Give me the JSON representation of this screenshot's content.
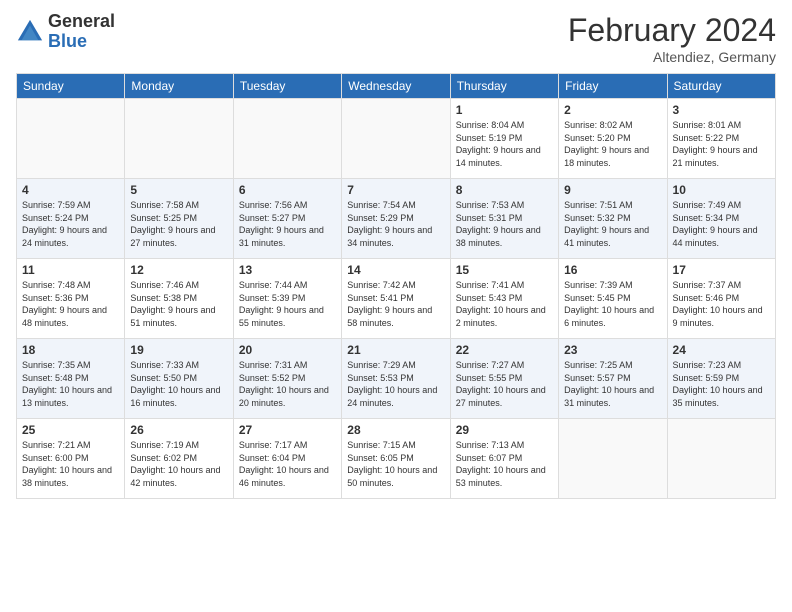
{
  "logo": {
    "general": "General",
    "blue": "Blue"
  },
  "title": "February 2024",
  "location": "Altendiez, Germany",
  "weekdays": [
    "Sunday",
    "Monday",
    "Tuesday",
    "Wednesday",
    "Thursday",
    "Friday",
    "Saturday"
  ],
  "weeks": [
    [
      {
        "day": "",
        "sunrise": "",
        "sunset": "",
        "daylight": ""
      },
      {
        "day": "",
        "sunrise": "",
        "sunset": "",
        "daylight": ""
      },
      {
        "day": "",
        "sunrise": "",
        "sunset": "",
        "daylight": ""
      },
      {
        "day": "",
        "sunrise": "",
        "sunset": "",
        "daylight": ""
      },
      {
        "day": "1",
        "sunrise": "Sunrise: 8:04 AM",
        "sunset": "Sunset: 5:19 PM",
        "daylight": "Daylight: 9 hours and 14 minutes."
      },
      {
        "day": "2",
        "sunrise": "Sunrise: 8:02 AM",
        "sunset": "Sunset: 5:20 PM",
        "daylight": "Daylight: 9 hours and 18 minutes."
      },
      {
        "day": "3",
        "sunrise": "Sunrise: 8:01 AM",
        "sunset": "Sunset: 5:22 PM",
        "daylight": "Daylight: 9 hours and 21 minutes."
      }
    ],
    [
      {
        "day": "4",
        "sunrise": "Sunrise: 7:59 AM",
        "sunset": "Sunset: 5:24 PM",
        "daylight": "Daylight: 9 hours and 24 minutes."
      },
      {
        "day": "5",
        "sunrise": "Sunrise: 7:58 AM",
        "sunset": "Sunset: 5:25 PM",
        "daylight": "Daylight: 9 hours and 27 minutes."
      },
      {
        "day": "6",
        "sunrise": "Sunrise: 7:56 AM",
        "sunset": "Sunset: 5:27 PM",
        "daylight": "Daylight: 9 hours and 31 minutes."
      },
      {
        "day": "7",
        "sunrise": "Sunrise: 7:54 AM",
        "sunset": "Sunset: 5:29 PM",
        "daylight": "Daylight: 9 hours and 34 minutes."
      },
      {
        "day": "8",
        "sunrise": "Sunrise: 7:53 AM",
        "sunset": "Sunset: 5:31 PM",
        "daylight": "Daylight: 9 hours and 38 minutes."
      },
      {
        "day": "9",
        "sunrise": "Sunrise: 7:51 AM",
        "sunset": "Sunset: 5:32 PM",
        "daylight": "Daylight: 9 hours and 41 minutes."
      },
      {
        "day": "10",
        "sunrise": "Sunrise: 7:49 AM",
        "sunset": "Sunset: 5:34 PM",
        "daylight": "Daylight: 9 hours and 44 minutes."
      }
    ],
    [
      {
        "day": "11",
        "sunrise": "Sunrise: 7:48 AM",
        "sunset": "Sunset: 5:36 PM",
        "daylight": "Daylight: 9 hours and 48 minutes."
      },
      {
        "day": "12",
        "sunrise": "Sunrise: 7:46 AM",
        "sunset": "Sunset: 5:38 PM",
        "daylight": "Daylight: 9 hours and 51 minutes."
      },
      {
        "day": "13",
        "sunrise": "Sunrise: 7:44 AM",
        "sunset": "Sunset: 5:39 PM",
        "daylight": "Daylight: 9 hours and 55 minutes."
      },
      {
        "day": "14",
        "sunrise": "Sunrise: 7:42 AM",
        "sunset": "Sunset: 5:41 PM",
        "daylight": "Daylight: 9 hours and 58 minutes."
      },
      {
        "day": "15",
        "sunrise": "Sunrise: 7:41 AM",
        "sunset": "Sunset: 5:43 PM",
        "daylight": "Daylight: 10 hours and 2 minutes."
      },
      {
        "day": "16",
        "sunrise": "Sunrise: 7:39 AM",
        "sunset": "Sunset: 5:45 PM",
        "daylight": "Daylight: 10 hours and 6 minutes."
      },
      {
        "day": "17",
        "sunrise": "Sunrise: 7:37 AM",
        "sunset": "Sunset: 5:46 PM",
        "daylight": "Daylight: 10 hours and 9 minutes."
      }
    ],
    [
      {
        "day": "18",
        "sunrise": "Sunrise: 7:35 AM",
        "sunset": "Sunset: 5:48 PM",
        "daylight": "Daylight: 10 hours and 13 minutes."
      },
      {
        "day": "19",
        "sunrise": "Sunrise: 7:33 AM",
        "sunset": "Sunset: 5:50 PM",
        "daylight": "Daylight: 10 hours and 16 minutes."
      },
      {
        "day": "20",
        "sunrise": "Sunrise: 7:31 AM",
        "sunset": "Sunset: 5:52 PM",
        "daylight": "Daylight: 10 hours and 20 minutes."
      },
      {
        "day": "21",
        "sunrise": "Sunrise: 7:29 AM",
        "sunset": "Sunset: 5:53 PM",
        "daylight": "Daylight: 10 hours and 24 minutes."
      },
      {
        "day": "22",
        "sunrise": "Sunrise: 7:27 AM",
        "sunset": "Sunset: 5:55 PM",
        "daylight": "Daylight: 10 hours and 27 minutes."
      },
      {
        "day": "23",
        "sunrise": "Sunrise: 7:25 AM",
        "sunset": "Sunset: 5:57 PM",
        "daylight": "Daylight: 10 hours and 31 minutes."
      },
      {
        "day": "24",
        "sunrise": "Sunrise: 7:23 AM",
        "sunset": "Sunset: 5:59 PM",
        "daylight": "Daylight: 10 hours and 35 minutes."
      }
    ],
    [
      {
        "day": "25",
        "sunrise": "Sunrise: 7:21 AM",
        "sunset": "Sunset: 6:00 PM",
        "daylight": "Daylight: 10 hours and 38 minutes."
      },
      {
        "day": "26",
        "sunrise": "Sunrise: 7:19 AM",
        "sunset": "Sunset: 6:02 PM",
        "daylight": "Daylight: 10 hours and 42 minutes."
      },
      {
        "day": "27",
        "sunrise": "Sunrise: 7:17 AM",
        "sunset": "Sunset: 6:04 PM",
        "daylight": "Daylight: 10 hours and 46 minutes."
      },
      {
        "day": "28",
        "sunrise": "Sunrise: 7:15 AM",
        "sunset": "Sunset: 6:05 PM",
        "daylight": "Daylight: 10 hours and 50 minutes."
      },
      {
        "day": "29",
        "sunrise": "Sunrise: 7:13 AM",
        "sunset": "Sunset: 6:07 PM",
        "daylight": "Daylight: 10 hours and 53 minutes."
      },
      {
        "day": "",
        "sunrise": "",
        "sunset": "",
        "daylight": ""
      },
      {
        "day": "",
        "sunrise": "",
        "sunset": "",
        "daylight": ""
      }
    ]
  ]
}
